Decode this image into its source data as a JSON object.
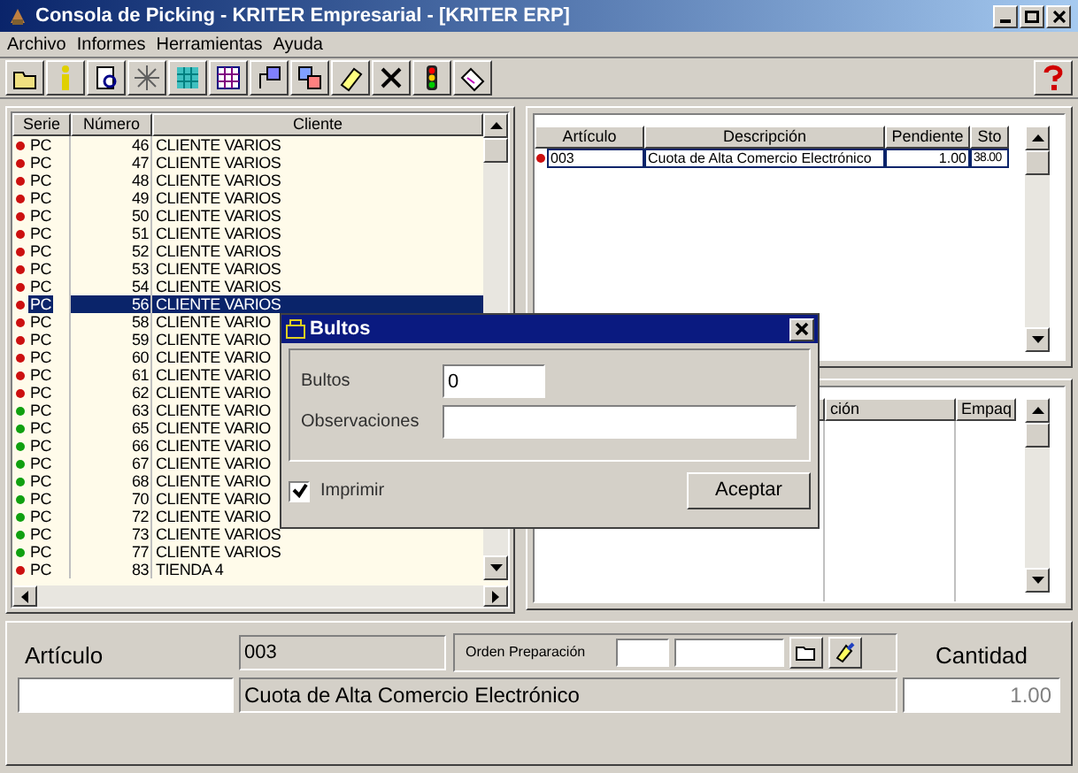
{
  "window": {
    "title": "Consola de Picking - KRITER Empresarial - [KRITER ERP]"
  },
  "menu": [
    "Archivo",
    "Informes",
    "Herramientas",
    "Ayuda"
  ],
  "orders": {
    "columns": [
      "Serie",
      "Número",
      "Cliente"
    ],
    "rows": [
      {
        "serie": "PC",
        "numero": "46",
        "cliente": "CLIENTE VARIOS",
        "color": "#cc1010",
        "selected": false
      },
      {
        "serie": "PC",
        "numero": "47",
        "cliente": "CLIENTE VARIOS",
        "color": "#cc1010",
        "selected": false
      },
      {
        "serie": "PC",
        "numero": "48",
        "cliente": "CLIENTE VARIOS",
        "color": "#cc1010",
        "selected": false
      },
      {
        "serie": "PC",
        "numero": "49",
        "cliente": "CLIENTE VARIOS",
        "color": "#cc1010",
        "selected": false
      },
      {
        "serie": "PC",
        "numero": "50",
        "cliente": "CLIENTE VARIOS",
        "color": "#cc1010",
        "selected": false
      },
      {
        "serie": "PC",
        "numero": "51",
        "cliente": "CLIENTE VARIOS",
        "color": "#cc1010",
        "selected": false
      },
      {
        "serie": "PC",
        "numero": "52",
        "cliente": "CLIENTE VARIOS",
        "color": "#cc1010",
        "selected": false
      },
      {
        "serie": "PC",
        "numero": "53",
        "cliente": "CLIENTE VARIOS",
        "color": "#cc1010",
        "selected": false
      },
      {
        "serie": "PC",
        "numero": "54",
        "cliente": "CLIENTE VARIOS",
        "color": "#cc1010",
        "selected": false
      },
      {
        "serie": "PC",
        "numero": "56",
        "cliente": "CLIENTE VARIOS",
        "color": "#cc1010",
        "selected": true
      },
      {
        "serie": "PC",
        "numero": "58",
        "cliente": "CLIENTE VARIO",
        "color": "#cc1010",
        "selected": false
      },
      {
        "serie": "PC",
        "numero": "59",
        "cliente": "CLIENTE VARIO",
        "color": "#cc1010",
        "selected": false
      },
      {
        "serie": "PC",
        "numero": "60",
        "cliente": "CLIENTE VARIO",
        "color": "#cc1010",
        "selected": false
      },
      {
        "serie": "PC",
        "numero": "61",
        "cliente": "CLIENTE VARIO",
        "color": "#cc1010",
        "selected": false
      },
      {
        "serie": "PC",
        "numero": "62",
        "cliente": "CLIENTE VARIO",
        "color": "#cc1010",
        "selected": false
      },
      {
        "serie": "PC",
        "numero": "63",
        "cliente": "CLIENTE VARIO",
        "color": "#10a010",
        "selected": false
      },
      {
        "serie": "PC",
        "numero": "65",
        "cliente": "CLIENTE VARIO",
        "color": "#10a010",
        "selected": false
      },
      {
        "serie": "PC",
        "numero": "66",
        "cliente": "CLIENTE VARIO",
        "color": "#10a010",
        "selected": false
      },
      {
        "serie": "PC",
        "numero": "67",
        "cliente": "CLIENTE VARIO",
        "color": "#10a010",
        "selected": false
      },
      {
        "serie": "PC",
        "numero": "68",
        "cliente": "CLIENTE VARIO",
        "color": "#10a010",
        "selected": false
      },
      {
        "serie": "PC",
        "numero": "70",
        "cliente": "CLIENTE VARIO",
        "color": "#10a010",
        "selected": false
      },
      {
        "serie": "PC",
        "numero": "72",
        "cliente": "CLIENTE VARIO",
        "color": "#10a010",
        "selected": false
      },
      {
        "serie": "PC",
        "numero": "73",
        "cliente": "CLIENTE VARIOS",
        "color": "#10a010",
        "selected": false
      },
      {
        "serie": "PC",
        "numero": "77",
        "cliente": "CLIENTE VARIOS",
        "color": "#10a010",
        "selected": false
      },
      {
        "serie": "PC",
        "numero": "83",
        "cliente": "TIENDA 4",
        "color": "#cc1010",
        "selected": false
      }
    ]
  },
  "lines": {
    "columns": [
      "Artículo",
      "Descripción",
      "Pendiente",
      "Sto"
    ],
    "rows": [
      {
        "articulo": "003",
        "descripcion": "Cuota de Alta Comercio Electrónico",
        "pendiente": "1.00",
        "stock": "38.00",
        "color": "#cc1010"
      }
    ]
  },
  "packing": {
    "columns": [
      "ción",
      "Empaq"
    ]
  },
  "dialog": {
    "title": "Bultos",
    "fields": [
      {
        "label": "Bultos",
        "value": "0"
      },
      {
        "label": "Observaciones"
      }
    ],
    "print": {
      "label": "Imprimir",
      "checked": true
    },
    "button": "Aceptar"
  },
  "bottom": {
    "articulo_label": "Artículo",
    "codigo": "003",
    "orden_label": "Orden Preparación",
    "cantidad_label": "Cantidad",
    "descripcion": "Cuota de Alta Comercio Electrónico",
    "cantidad": "1.00"
  }
}
